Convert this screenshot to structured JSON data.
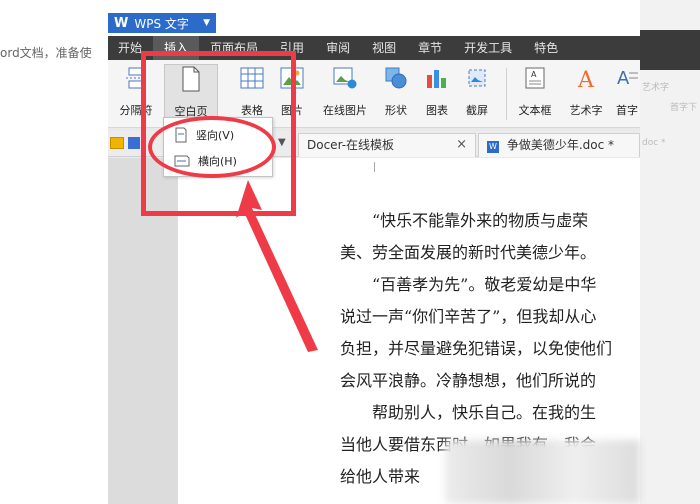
{
  "background": {
    "hint_text": "ord文档，准备使",
    "right_ghost_1": "艺术字",
    "right_ghost_2": "首字下",
    "right_ghost_3": "doc *"
  },
  "title_bar": {
    "app_name": "WPS 文字"
  },
  "menu": {
    "items": [
      "开始",
      "插入",
      "页面布局",
      "引用",
      "审阅",
      "视图",
      "章节",
      "开发工具",
      "特色"
    ]
  },
  "ribbon": {
    "separator_label": "分隔符",
    "blank_page_label": "空白页",
    "table_label": "表格",
    "picture_label": "图片",
    "online_picture_label": "在线图片",
    "shape_label": "形状",
    "chart_label": "图表",
    "screenshot_label": "截屏",
    "textbox_label": "文本框",
    "wordart_label": "艺术字",
    "dropcap_label": "首字"
  },
  "dropdown": {
    "portrait_label": "竖向(V)",
    "landscape_label": "横向(H)"
  },
  "tabs": {
    "docer": "Docer-在线模板",
    "document": "争做美德少年.doc *"
  },
  "document": {
    "lines": [
      "“快乐不能靠外来的物质与虚荣",
      "美、劳全面发展的新时代美德少年。",
      "“百善孝为先”。敬老爱幼是中华",
      "说过一声“你们辛苦了”，但我却从心",
      "负担，并尽量避免犯错误，以免使他们",
      "会风平浪静。冷静想想，他们所说的",
      "帮助别人，快乐自己。在我的生",
      "当他人要借东西时，如果我有，我会",
      "给他人带来"
    ]
  },
  "colors": {
    "annotation_red": "#ee3b47",
    "wps_blue": "#2c6bc9",
    "menu_bar": "#3c3c3c"
  }
}
